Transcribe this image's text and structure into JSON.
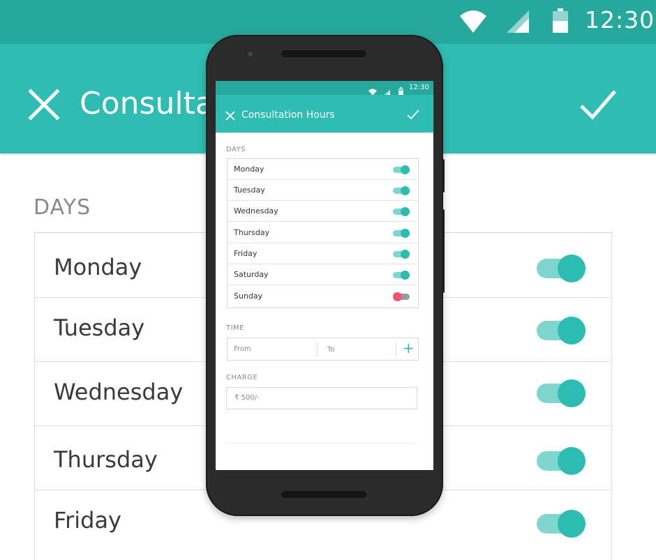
{
  "colors": {
    "status_bar": "#26a89c",
    "toolbar": "#2fbcb2",
    "toggle_on_knob": "#2bbdb1",
    "toggle_on_track": "#7fd6cf",
    "toggle_off_knob": "#f0566c",
    "toggle_off_track": "#9a9a9a"
  },
  "background_screen": {
    "status_bar": {
      "time": "12:30",
      "icons": [
        "wifi-icon",
        "signal-icon",
        "battery-icon"
      ]
    },
    "toolbar": {
      "title": "Consultation Hours",
      "close_icon": "close-icon",
      "check_icon": "check-icon"
    },
    "days_label": "DAYS",
    "days": [
      {
        "label": "Monday",
        "enabled": true
      },
      {
        "label": "Tuesday",
        "enabled": true
      },
      {
        "label": "Wednesday",
        "enabled": true
      },
      {
        "label": "Thursday",
        "enabled": true
      },
      {
        "label": "Friday",
        "enabled": true
      }
    ]
  },
  "phone_screen": {
    "status_bar": {
      "time": "12:30",
      "icons": [
        "wifi-icon",
        "signal-icon",
        "battery-icon"
      ]
    },
    "toolbar": {
      "title": "Consultation Hours",
      "close_icon": "close-icon",
      "check_icon": "check-icon"
    },
    "days_label": "DAYS",
    "days": [
      {
        "label": "Monday",
        "enabled": true
      },
      {
        "label": "Tuesday",
        "enabled": true
      },
      {
        "label": "Wednesday",
        "enabled": true
      },
      {
        "label": "Thursday",
        "enabled": true
      },
      {
        "label": "Friday",
        "enabled": true
      },
      {
        "label": "Saturday",
        "enabled": true
      },
      {
        "label": "Sunday",
        "enabled": false
      }
    ],
    "time_label": "TIME",
    "time": {
      "from_placeholder": "From",
      "to_placeholder": "To",
      "add_icon": "plus-icon"
    },
    "charge_label": "CHARGE",
    "charge": {
      "value": "₹  500/-"
    }
  }
}
